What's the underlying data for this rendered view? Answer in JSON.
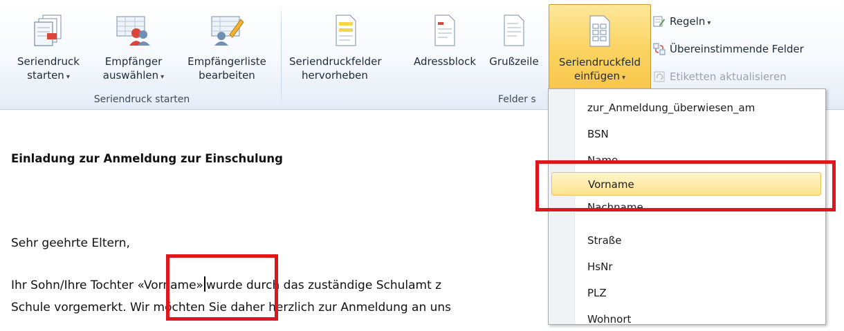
{
  "ribbon": {
    "groups": [
      {
        "label": "Seriendruck starten"
      },
      {
        "label": "Felder s"
      }
    ],
    "buttons": {
      "start_mail_merge": {
        "line1": "Seriendruck",
        "line2": "starten",
        "icon": "start-mail-merge-icon"
      },
      "select_recipients": {
        "line1": "Empfänger",
        "line2": "auswählen",
        "icon": "select-recipients-icon"
      },
      "edit_recipient_list": {
        "line1": "Empfängerliste",
        "line2": "bearbeiten",
        "icon": "edit-recipient-list-icon"
      },
      "highlight_merge_fields": {
        "line1": "Seriendruckfelder",
        "line2": "hervorheben",
        "icon": "highlight-fields-icon"
      },
      "address_block": {
        "line1": "Adressblock",
        "line2": "",
        "icon": "address-block-icon"
      },
      "greeting_line": {
        "line1": "Grußzeile",
        "line2": "",
        "icon": "greeting-line-icon"
      },
      "insert_merge_field": {
        "line1": "Seriendruckfeld",
        "line2": "einfügen",
        "icon": "insert-merge-field-icon"
      }
    },
    "small_buttons": {
      "rules": "Regeln",
      "match_fields": "Übereinstimmende Felder",
      "update_labels": "Etiketten aktualisieren"
    },
    "dropdown_glyph": "▾",
    "accent_color": "#fbd463"
  },
  "document": {
    "heading": "Einladung zur Anmeldung zur Einschulung",
    "greeting": "Sehr geehrte Eltern,",
    "line1_before": "Ihr Sohn/Ihre Tochter ",
    "merge_field": "«Vorname»",
    "line1_after": "wurde durch das zuständige Schulamt z",
    "line2": "Schule vorgemerkt.  Wir möchten Sie daher herzlich zur Anmeldung an uns"
  },
  "dropdown": {
    "items": [
      "zur_Anmeldung_überwiesen_am",
      "BSN",
      "Name",
      "Vorname",
      "Nachname",
      "Straße",
      "HsNr",
      "PLZ",
      "Wohnort"
    ],
    "selected": "Vorname"
  },
  "highlight_color": "#e0161f"
}
